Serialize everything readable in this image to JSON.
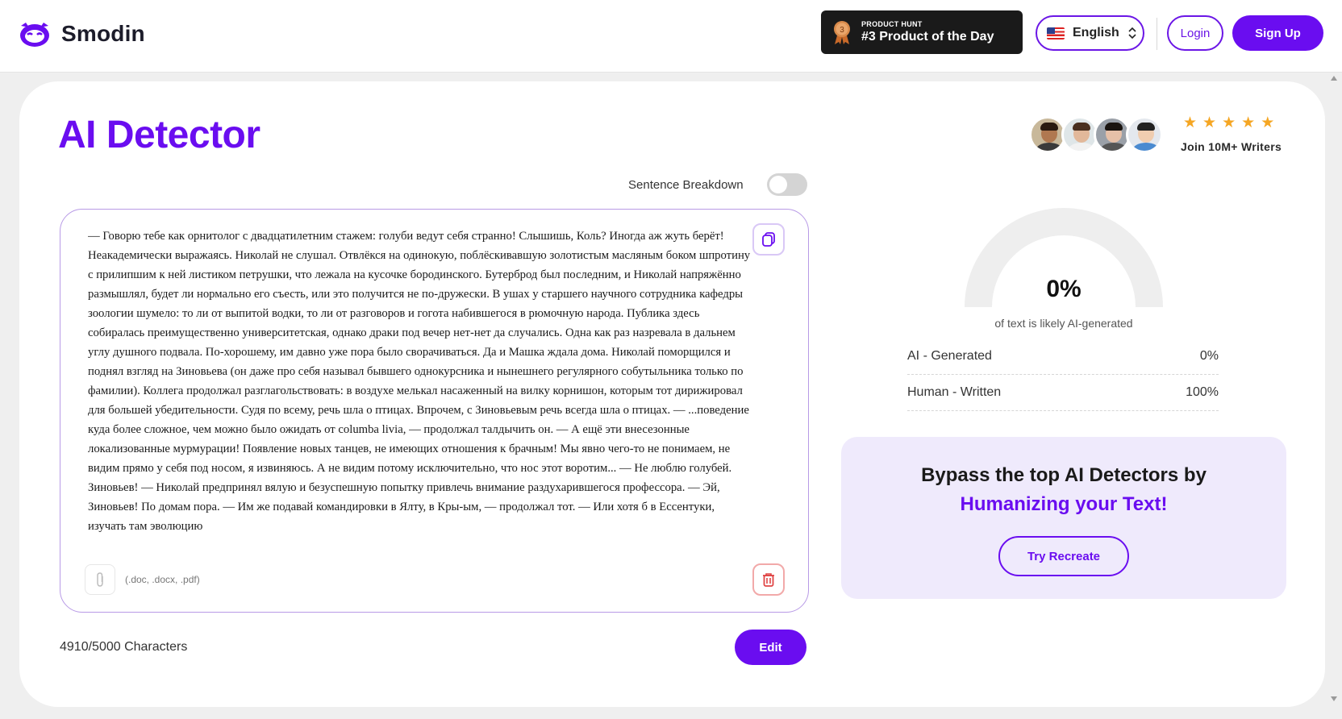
{
  "brand": {
    "name": "Smodin",
    "accent": "#6a0df0"
  },
  "header": {
    "product_hunt": {
      "small_label": "PRODUCT HUNT",
      "big_label": "#3 Product of the Day",
      "medal_number": "3"
    },
    "language": {
      "label": "English",
      "flag_icon": "us-flag-icon"
    },
    "login_label": "Login",
    "signup_label": "Sign Up"
  },
  "page": {
    "title": "AI Detector",
    "join_text": "Join 10M+ Writers",
    "rating_stars": 5,
    "sentence_breakdown_label": "Sentence Breakdown",
    "sentence_breakdown_on": false
  },
  "editor": {
    "text": "— Говорю тебе как орнитолог с двадцатилетним стажем: голуби ведут себя странно! Слышишь, Коль? Иногда аж жуть берёт! Неакадемически выражаясь. Николай не слушал. Отвлёкся на одинокую, поблёскивавшую золотистым масляным боком шпротину с прилипшим к ней листиком петрушки, что лежала на кусочке бородинского. Бутерброд был последним, и Николай напряжённо размышлял, будет ли нормально его съесть, или это получится не по-дружески. В ушах у старшего научного сотрудника кафедры зоологии шумело: то ли от выпитой водки, то ли от разговоров и гогота набившегося в рюмочную народа. Публика здесь собиралась преимущественно университетская, однако драки под вечер нет-нет да случались. Одна как раз назревала в дальнем углу душного подвала. По-хорошему, им давно уже пора было сворачиваться. Да и Машка ждала дома. Николай поморщился и поднял взгляд на Зиновьева (он даже про себя называл бывшего однокурсника и нынешнего регулярного собутыльника только по фамилии). Коллега продолжал разглагольствовать: в воздухе мелькал насаженный на вилку корнишон, которым тот дирижировал для большей убедительности. Судя по всему, речь шла о птицах. Впрочем, с Зиновьевым речь всегда шла о птицах. — ...поведение куда более сложное, чем можно было ожидать от columba livia, — продолжал талдычить он. — А ещё эти внесезонные локализованные мурмурации! Появление новых танцев, не имеющих отношения к брачным! Мы явно чего-то не понимаем, не видим прямо у себя под носом, я извиняюсь. А не видим потому исключительно, что нос этот воротим... — Не люблю голубей. Зиновьев! — Николай предпринял вялую и безуспешную попытку привлечь внимание раздухарившегося профессора. — Эй, Зиновьев! По домам пора. — Им же подавай командировки в Ялту, в Кры-ым, — продолжал тот. — Или хотя б в Ессентуки, изучать там эволюцию",
    "file_hint": "(.doc, .docx, .pdf)",
    "char_count": "4910/5000 Characters",
    "edit_label": "Edit"
  },
  "result": {
    "percent": "0%",
    "ai_fraction": 0,
    "caption": "of text is likely AI-generated",
    "rows": [
      {
        "label": "AI - Generated",
        "value": "0%"
      },
      {
        "label": "Human - Written",
        "value": "100%"
      }
    ]
  },
  "promo": {
    "line1": "Bypass the top AI Detectors by",
    "line2": "Humanizing your Text!",
    "button_label": "Try Recreate"
  }
}
